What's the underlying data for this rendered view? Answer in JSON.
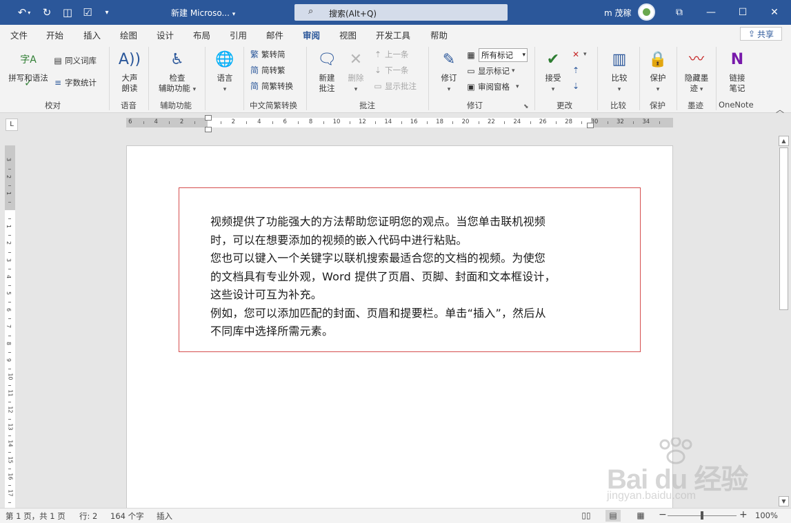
{
  "titlebar": {
    "doc_title": "新建 Microso...",
    "search_placeholder": "搜索(Alt+Q)",
    "user_name": "m 茂稼",
    "bg_color": "#2b579a"
  },
  "tabs": [
    "文件",
    "开始",
    "插入",
    "绘图",
    "设计",
    "布局",
    "引用",
    "邮件",
    "审阅",
    "视图",
    "开发工具",
    "帮助"
  ],
  "active_tab": "审阅",
  "share_label": "共享",
  "ribbon": {
    "spell_check": "拼写和语法",
    "thesaurus": "同义词库",
    "word_count": "字数统计",
    "group_proofing": "校对",
    "read_aloud_1": "大声",
    "read_aloud_2": "朗读",
    "group_speech": "语音",
    "check_accessibility_1": "检查",
    "check_accessibility_2": "辅助功能",
    "group_accessibility": "辅助功能",
    "language": "语言",
    "to_simplified": "繁转简",
    "to_traditional": "简转繁",
    "convert": "简繁转换",
    "group_chinese": "中文简繁转换",
    "new_comment_1": "新建",
    "new_comment_2": "批注",
    "delete": "删除",
    "previous": "上一条",
    "next": "下一条",
    "show_comments": "显示批注",
    "group_comments": "批注",
    "track_changes": "修订",
    "markup_select": "所有标记",
    "show_markup": "显示标记",
    "reviewing_pane": "审阅窗格",
    "group_tracking": "修订",
    "accept": "接受",
    "group_changes": "更改",
    "compare": "比较",
    "group_compare": "比较",
    "protect": "保护",
    "group_protect": "保护",
    "hide_ink_1": "隐藏墨",
    "hide_ink_2": "迹",
    "group_ink": "墨迹",
    "onenote_1": "链接",
    "onenote_2": "笔记",
    "group_onenote": "OneNote"
  },
  "document": {
    "para1_line1": "视频提供了功能强大的方法帮助您证明您的观点。当您单击联机视频",
    "para1_line2": "时，可以在想要添加的视频的嵌入代码中进行粘贴。",
    "para2_line1": "您也可以键入一个关键字以联机搜索最适合您的文档的视频。为使您",
    "para2_line2": "的文档具有专业外观，Word  提供了页眉、页脚、封面和文本框设计，",
    "para2_line3": "这些设计可互为补充。",
    "para3_line1": "例如，您可以添加匹配的封面、页眉和提要栏。单击“插入”，然后从",
    "para3_line2": "不同库中选择所需元素。"
  },
  "watermark": {
    "logo": "Bai du 经验",
    "url": "jingyan.baidu.com"
  },
  "statusbar": {
    "page": "第 1 页，共 1 页",
    "line": "行: 2",
    "words": "164 个字",
    "mode": "插入",
    "zoom": "100%",
    "zoom_level": 1.0
  }
}
